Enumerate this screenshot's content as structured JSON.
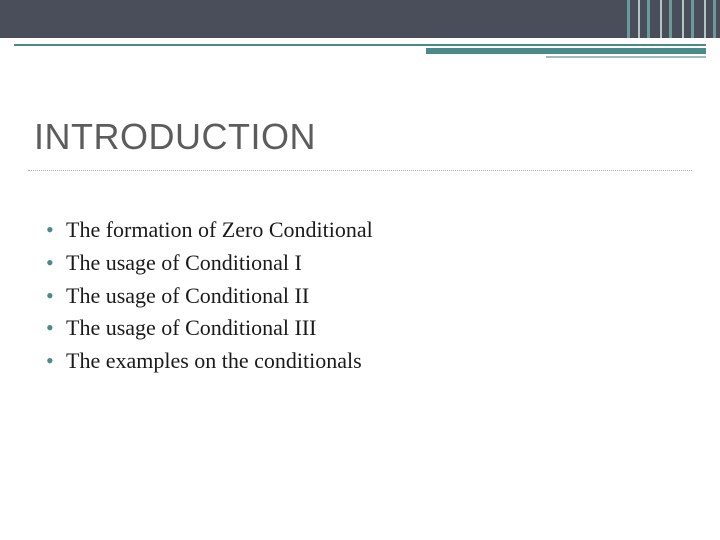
{
  "slide": {
    "title": "INTRODUCTION",
    "bullets": [
      "The formation of Zero Conditional",
      "The usage of Conditional I",
      "The usage of Conditional II",
      "The usage of Conditional III",
      "The examples on the conditionals"
    ]
  }
}
